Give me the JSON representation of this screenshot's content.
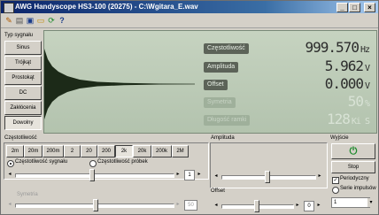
{
  "window": {
    "title": "AWG Handyscope HS3-100 (20275) - C:\\Wgitara_E.wav",
    "minimize": "_",
    "maximize": "□",
    "close": "×"
  },
  "toolbar": {
    "help": "?"
  },
  "signal_type": {
    "label": "Typ sygnału",
    "buttons": [
      "Sinus",
      "Trójkąt",
      "Prostokąt",
      "DC",
      "Zakłócenia",
      "Dowolny"
    ],
    "selected": "Dowolny"
  },
  "readouts": [
    {
      "label": "Częstotliwość",
      "value": "999.570",
      "unit": "Hz",
      "enabled": true
    },
    {
      "label": "Amplituda",
      "value": "5.962",
      "unit": "V",
      "enabled": true
    },
    {
      "label": "Offset",
      "value": "0.000",
      "unit": "V",
      "enabled": true
    },
    {
      "label": "Symetria",
      "value": "50",
      "unit": "%",
      "enabled": false
    },
    {
      "label": "Długość ramki",
      "value": "128",
      "unit": "Ki S",
      "enabled": false
    }
  ],
  "frequency": {
    "label": "Częstotliwość",
    "ranges": [
      "2m",
      "20m",
      "200m",
      "2",
      "20",
      "200",
      "2k",
      "20k",
      "200k",
      "2M"
    ],
    "selected": "2k",
    "mode_options": [
      "Częstotliwość sygnału",
      "Częstotliwość próbek"
    ],
    "mode_selected": "Częstotliwość sygnału",
    "spin_value": "1",
    "symmetry_label": "Symetria",
    "symmetry_spin": "50"
  },
  "amplitude": {
    "label": "Amplituda"
  },
  "offset": {
    "label": "Offset",
    "spin_value": "0"
  },
  "output": {
    "label": "Wyjście",
    "stop_label": "Stop",
    "periodic_label": "Periodyczny",
    "periodic_checked": true,
    "series_label": "Serie impulsów",
    "dropdown_value": "1"
  },
  "colors": {
    "screen_bg": "#b8c8b4",
    "readout_text": "#2c2c2c",
    "titlebar": "#0b246a",
    "wave": "#1c2a18"
  }
}
